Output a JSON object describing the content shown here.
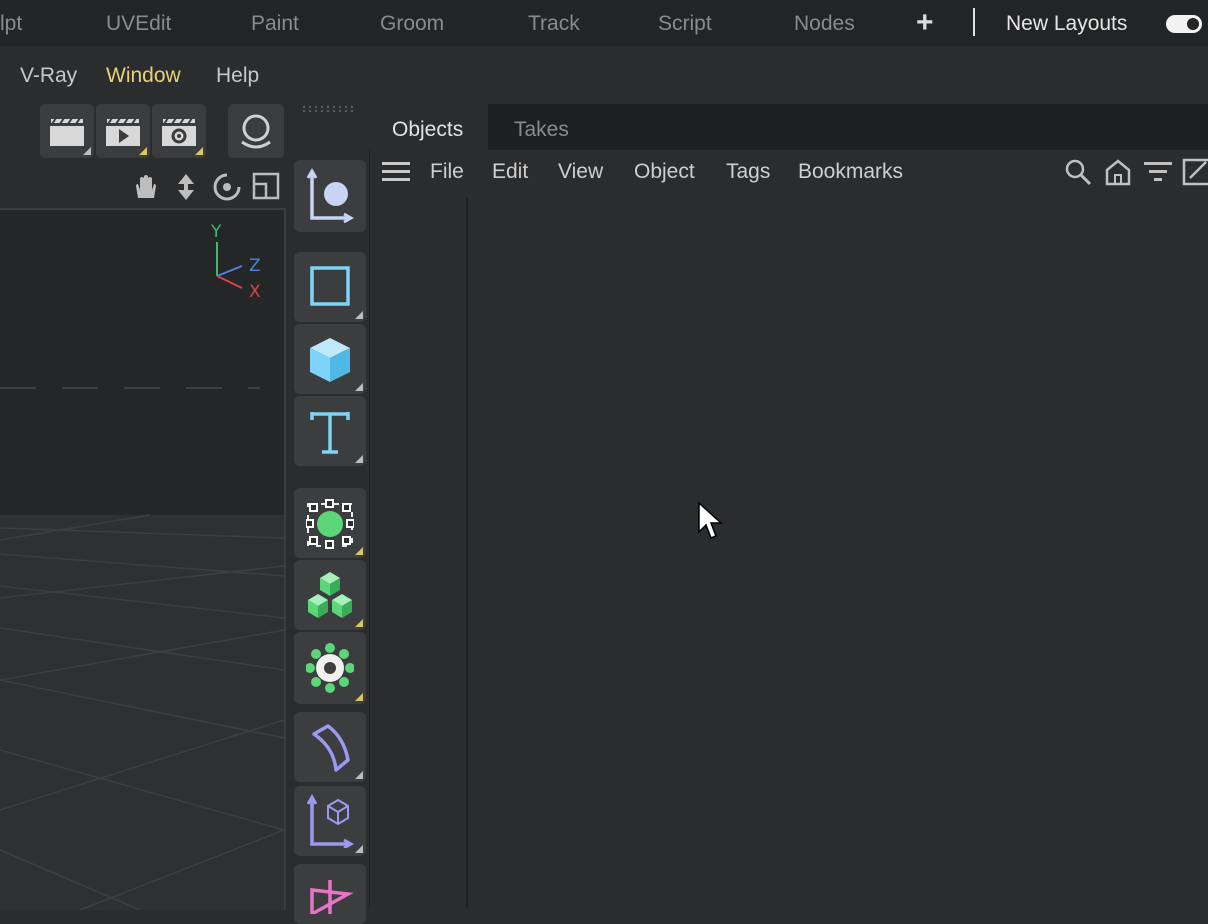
{
  "layout_tabs": [
    "lpt",
    "UVEdit",
    "Paint",
    "Groom",
    "Track",
    "Script",
    "Nodes"
  ],
  "new_layouts_label": "New Layouts",
  "new_layouts_toggle": true,
  "main_menu": [
    "V-Ray",
    "Window",
    "Help"
  ],
  "highlighted_menu": "Window",
  "axis": {
    "y": "Y",
    "z": "Z",
    "x": "X"
  },
  "object_manager": {
    "tabs": [
      "Objects",
      "Takes"
    ],
    "active_tab": "Objects",
    "menu": [
      "File",
      "Edit",
      "View",
      "Object",
      "Tags",
      "Bookmarks"
    ]
  },
  "colors": {
    "accent_yellow": "#e8d17a",
    "primitive_blue": "#7dd3f8",
    "generator_green": "#5dd67a",
    "deformer_purple": "#9a9af0"
  }
}
